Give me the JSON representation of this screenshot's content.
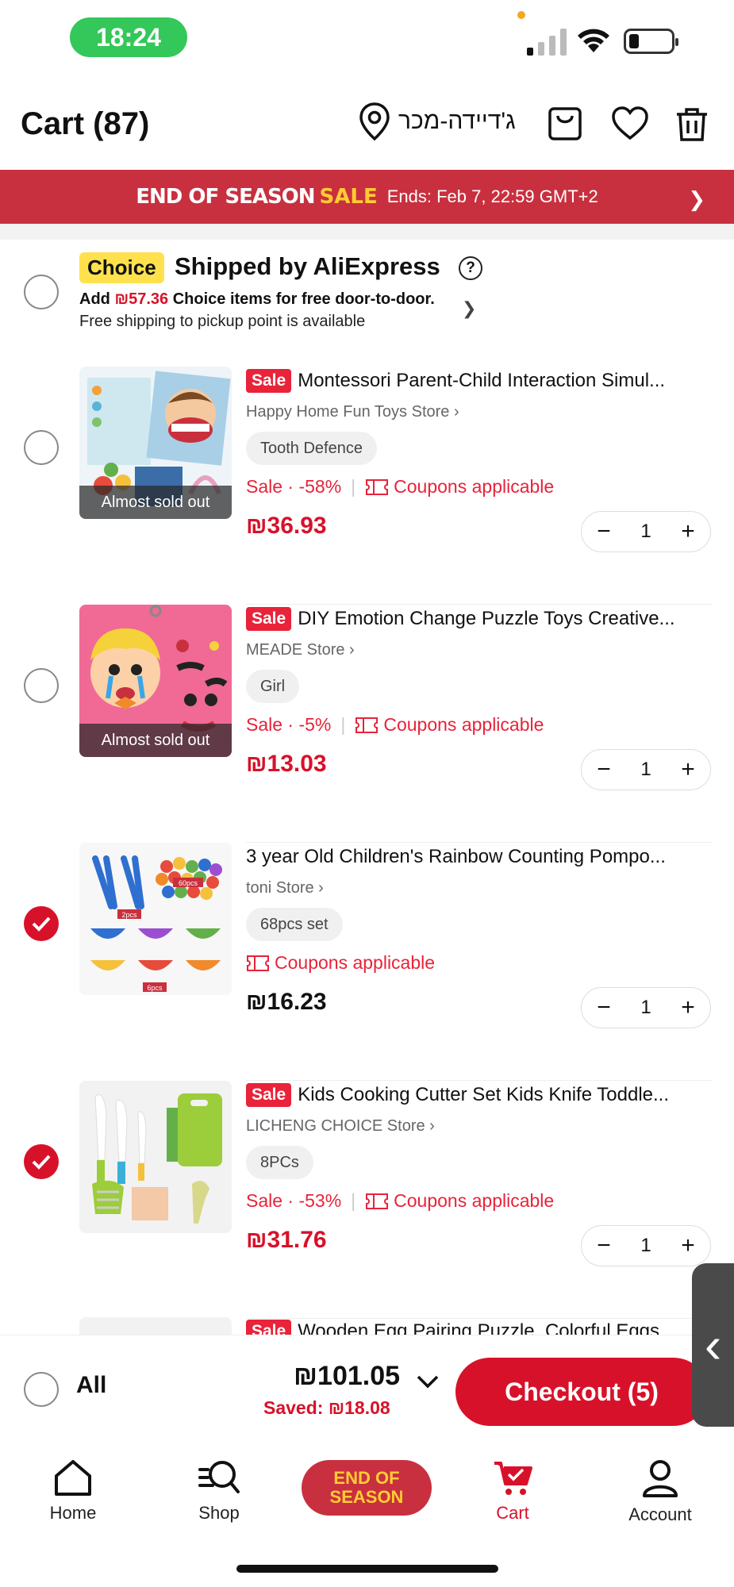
{
  "status_bar": {
    "time": "18:24"
  },
  "header": {
    "title": "Cart (87)",
    "location": "ג'דיידה-מכר"
  },
  "promo": {
    "event": "END OF SEASON",
    "sale": "SALE",
    "ends": "Ends: Feb 7, 22:59 GMT+2"
  },
  "choice": {
    "badge": "Choice",
    "title": "Shipped by AliExpress",
    "help": "?",
    "add_prefix": "Add ",
    "add_amount": "₪57.36",
    "add_suffix": " Choice items for free door-to-door.",
    "free_pickup": "Free shipping to pickup point is available"
  },
  "items": [
    {
      "checked": false,
      "sale_tag": "Sale",
      "title": "Montessori Parent-Child Interaction Simul...",
      "store": "Happy Home Fun Toys Store",
      "variant": "Tooth Defence",
      "discount": "Sale · -58%",
      "coupon": "Coupons applicable",
      "price": "₪36.93",
      "qty": "1",
      "overlay": "Almost sold out"
    },
    {
      "checked": false,
      "sale_tag": "Sale",
      "title": "DIY Emotion Change Puzzle Toys Creative...",
      "store": "MEADE Store",
      "variant": "Girl",
      "discount": "Sale · -5%",
      "coupon": "Coupons applicable",
      "price": "₪13.03",
      "qty": "1",
      "overlay": "Almost sold out"
    },
    {
      "checked": true,
      "sale_tag": "",
      "title": "3 year Old  Children's Rainbow Counting Pompo...",
      "store": "toni Store",
      "variant": "68pcs set",
      "discount": "",
      "coupon": "Coupons applicable",
      "price": "₪16.23",
      "qty": "1",
      "overlay": "",
      "img_labels": [
        "60pcs",
        "2pcs",
        "6pcs"
      ]
    },
    {
      "checked": true,
      "sale_tag": "Sale",
      "title": "Kids Cooking Cutter Set Kids Knife Toddle...",
      "store": "LICHENG CHOICE Store",
      "variant": "8PCs",
      "discount": "Sale · -53%",
      "coupon": "Coupons applicable",
      "price": "₪31.76",
      "qty": "1",
      "overlay": ""
    },
    {
      "sale_tag": "Sale",
      "title": "Wooden Egg Pairing Puzzle, Colorful Eggs..."
    }
  ],
  "checkout": {
    "all_label": "All",
    "total": "₪101.05",
    "saved": "Saved: ₪18.08",
    "button": "Checkout (5)"
  },
  "nav": {
    "home": "Home",
    "shop": "Shop",
    "eos_line1": "END OF",
    "eos_line2": "SEASON",
    "cart": "Cart",
    "account": "Account"
  },
  "colors": {
    "accent": "#d8112a",
    "banner": "#c8303f",
    "choice_yellow": "#ffe14d",
    "status_green": "#34c759"
  }
}
